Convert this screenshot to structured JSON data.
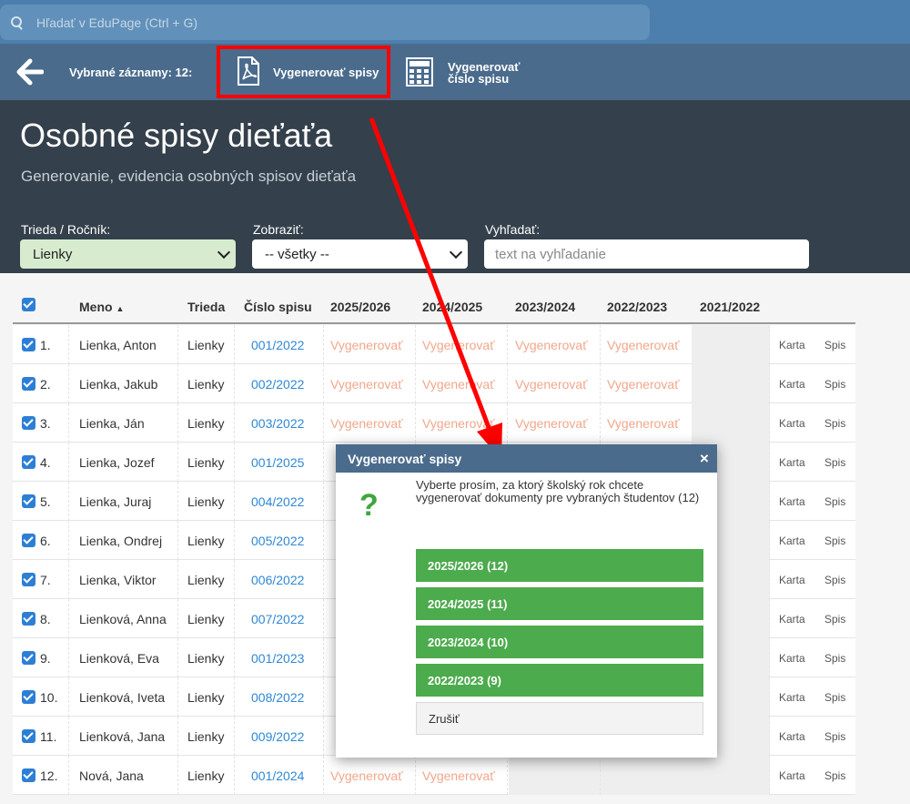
{
  "search": {
    "placeholder": "Hľadať v EduPage (Ctrl + G)"
  },
  "toolbar": {
    "selected_label": "Vybrané záznamy: 12:",
    "generate_files_label": "Vygenerovať spisy",
    "generate_number_line1": "Vygenerovať",
    "generate_number_line2": "číslo spisu"
  },
  "header": {
    "title": "Osobné spisy dieťaťa",
    "subtitle": "Generovanie, evidencia osobných spisov dieťaťa"
  },
  "filters": {
    "class_label": "Trieda / Ročník:",
    "class_value": "Lienky",
    "show_label": "Zobraziť:",
    "show_value": "-- všetky --",
    "search_label": "Vyhľadať:",
    "search_placeholder": "text na vyhľadanie"
  },
  "table": {
    "headers": {
      "name": "Meno",
      "sort_arrow": "▲",
      "class": "Trieda",
      "file_no": "Číslo spisu",
      "y1": "2025/2026",
      "y2": "2024/2025",
      "y3": "2023/2024",
      "y4": "2022/2023",
      "y5": "2021/2022"
    },
    "card_label": "Karta",
    "file_label": "Spis",
    "rows": [
      {
        "n": "1.",
        "name": "Lienka, Anton",
        "class": "Lienky",
        "file_no": "001/2022",
        "y1": "Vygenerovať",
        "y2": "Vygenerovať",
        "y3": "Vygenerovať",
        "y4": "Vygenerovať"
      },
      {
        "n": "2.",
        "name": "Lienka, Jakub",
        "class": "Lienky",
        "file_no": "002/2022",
        "y1": "Vygenerovať",
        "y2": "Vygenerovať",
        "y3": "Vygenerovať",
        "y4": "Vygenerovať"
      },
      {
        "n": "3.",
        "name": "Lienka, Ján",
        "class": "Lienky",
        "file_no": "003/2022",
        "y1": "Vygenerovať",
        "y2": "Vygenerovať",
        "y3": "Vygenerovať",
        "y4": "Vygenerovať"
      },
      {
        "n": "4.",
        "name": "Lienka, Jozef",
        "class": "Lienky",
        "file_no": "001/2025"
      },
      {
        "n": "5.",
        "name": "Lienka, Juraj",
        "class": "Lienky",
        "file_no": "004/2022"
      },
      {
        "n": "6.",
        "name": "Lienka, Ondrej",
        "class": "Lienky",
        "file_no": "005/2022"
      },
      {
        "n": "7.",
        "name": "Lienka, Viktor",
        "class": "Lienky",
        "file_no": "006/2022"
      },
      {
        "n": "8.",
        "name": "Lienková, Anna",
        "class": "Lienky",
        "file_no": "007/2022"
      },
      {
        "n": "9.",
        "name": "Lienková, Eva",
        "class": "Lienky",
        "file_no": "001/2023"
      },
      {
        "n": "10.",
        "name": "Lienková, Iveta",
        "class": "Lienky",
        "file_no": "008/2022"
      },
      {
        "n": "11.",
        "name": "Lienková, Jana",
        "class": "Lienky",
        "file_no": "009/2022"
      },
      {
        "n": "12.",
        "name": "Nová, Jana",
        "class": "Lienky",
        "file_no": "001/2024",
        "y1": "Vygenerovať",
        "y2": "Vygenerovať"
      }
    ]
  },
  "modal": {
    "title": "Vygenerovať spisy",
    "close": "×",
    "icon": "question-mark-icon",
    "message": "Vyberte prosím, za ktorý školský rok chcete vygenerovať dokumenty pre vybraných študentov (12)",
    "buttons": [
      "2025/2026 (12)",
      "2024/2025 (11)",
      "2023/2024 (10)",
      "2022/2023 (9)"
    ],
    "cancel": "Zrušiť"
  },
  "colors": {
    "accent_blue": "#2d88d6",
    "generate_text": "#f0a78c",
    "green_button": "#4cab4c",
    "highlight_red": "#ff0000",
    "header_dark": "#34404b"
  }
}
